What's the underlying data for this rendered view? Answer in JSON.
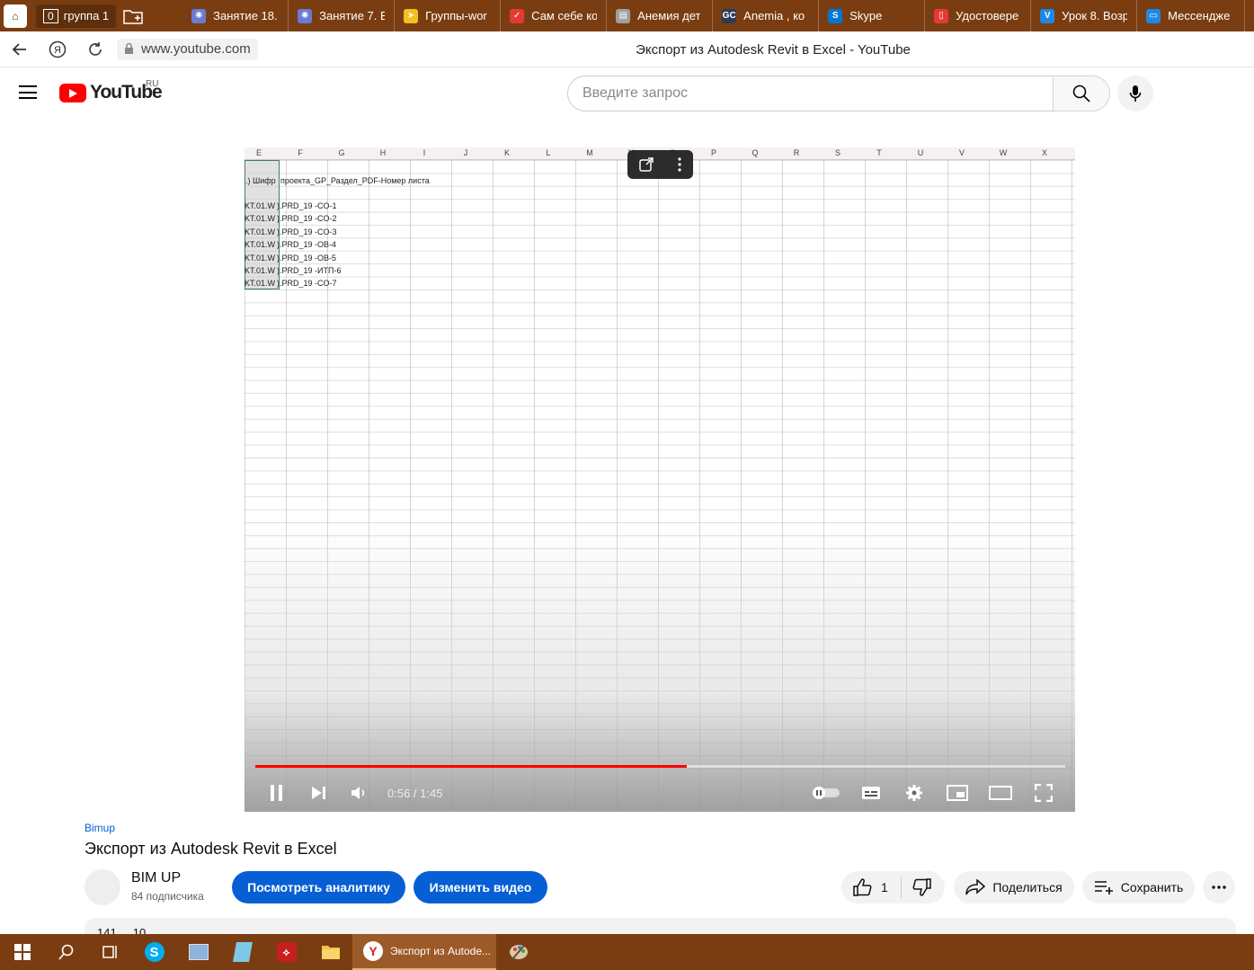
{
  "browser": {
    "tab_group": {
      "count": "0",
      "label": "группа 1"
    },
    "tabs": [
      {
        "title": "Занятие 18.",
        "icon": "stellar-icon",
        "color": "#6b7bd3"
      },
      {
        "title": "Занятие 7. В",
        "icon": "stellar-icon",
        "color": "#6b7bd3"
      },
      {
        "title": "Группы-wor",
        "icon": "ribbon-icon",
        "color": "#f3c21a"
      },
      {
        "title": "Сам себе ко",
        "icon": "checkmark-icon",
        "color": "#e53935"
      },
      {
        "title": "Анемия дет",
        "icon": "document-icon",
        "color": "#9e9e9e"
      },
      {
        "title": "Anemia , ко",
        "icon": "gc-icon",
        "color": "#2d3b55"
      },
      {
        "title": "Skype",
        "icon": "skype-icon",
        "color": "#0078d4"
      },
      {
        "title": "Удостовере",
        "icon": "pdf-icon",
        "color": "#e53935"
      },
      {
        "title": "Урок 8. Возр",
        "icon": "v-icon",
        "color": "#1e88e5"
      },
      {
        "title": "Мессендже",
        "icon": "messenger-icon",
        "color": "#1e88e5"
      }
    ],
    "url": "www.youtube.com",
    "page_title": "Экспорт из Autodesk Revit в Excel - YouTube"
  },
  "youtube": {
    "logo_text": "YouTube",
    "region": "RU",
    "search_placeholder": "Введите запрос"
  },
  "spreadsheet": {
    "columns": [
      "E",
      "F",
      "G",
      "H",
      "I",
      "J",
      "K",
      "L",
      "M",
      "N",
      "O",
      "P",
      "Q",
      "R",
      "S",
      "T",
      "U",
      "V",
      "W",
      "X"
    ],
    "header_cell_e": ".) Шифр",
    "header_cell_f": "проекта_GP_Раздел_PDF-Номер листа",
    "rows_e": [
      "KT.01.W",
      "KT.01.W",
      "KT.01.W",
      "KT.01.W",
      "KT.01.W",
      "KT.01.W",
      "KT.01.W"
    ],
    "rows_f": [
      ").PRD_19 -CO-1",
      ").PRD_19 -CO-2",
      ").PRD_19 -CO-3",
      ").PRD_19 -OB-4",
      ").PRD_19 -OB-5",
      ").PRD_19 -ИТП-6",
      ").PRD_19 -CO-7"
    ]
  },
  "player": {
    "time": "0:56 / 1:45",
    "progress": 0.533
  },
  "video": {
    "channel_link": "Bimup",
    "title": "Экспорт из Autodesk Revit в Excel",
    "channel_name": "BIM UP",
    "subscribers": "84 подписчика",
    "analytics_label": "Посмотреть аналитику",
    "edit_label": "Изменить видео",
    "likes": "1",
    "share_label": "Поделиться",
    "save_label": "Сохранить",
    "description_peek": "141 ... 10"
  },
  "taskbar": {
    "active_title": "Экспорт из Autode..."
  }
}
